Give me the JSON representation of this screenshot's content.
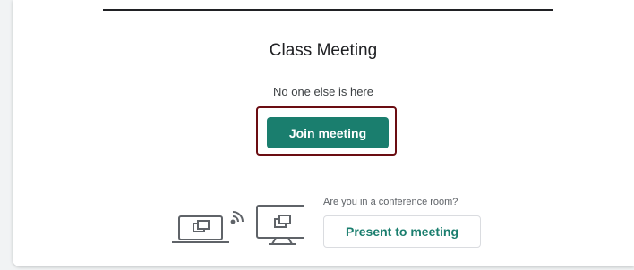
{
  "meeting": {
    "title": "Class Meeting",
    "status_text": "No one else is here",
    "join_label": "Join meeting"
  },
  "present": {
    "question": "Are you in a conference room?",
    "button_label": "Present to meeting"
  },
  "icons": {
    "illustration": "laptop-cast-to-display-icon"
  },
  "colors": {
    "accent": "#1a7e6e",
    "highlight_border": "#6b0d12",
    "text_primary": "#202124",
    "text_secondary": "#5f6368"
  }
}
